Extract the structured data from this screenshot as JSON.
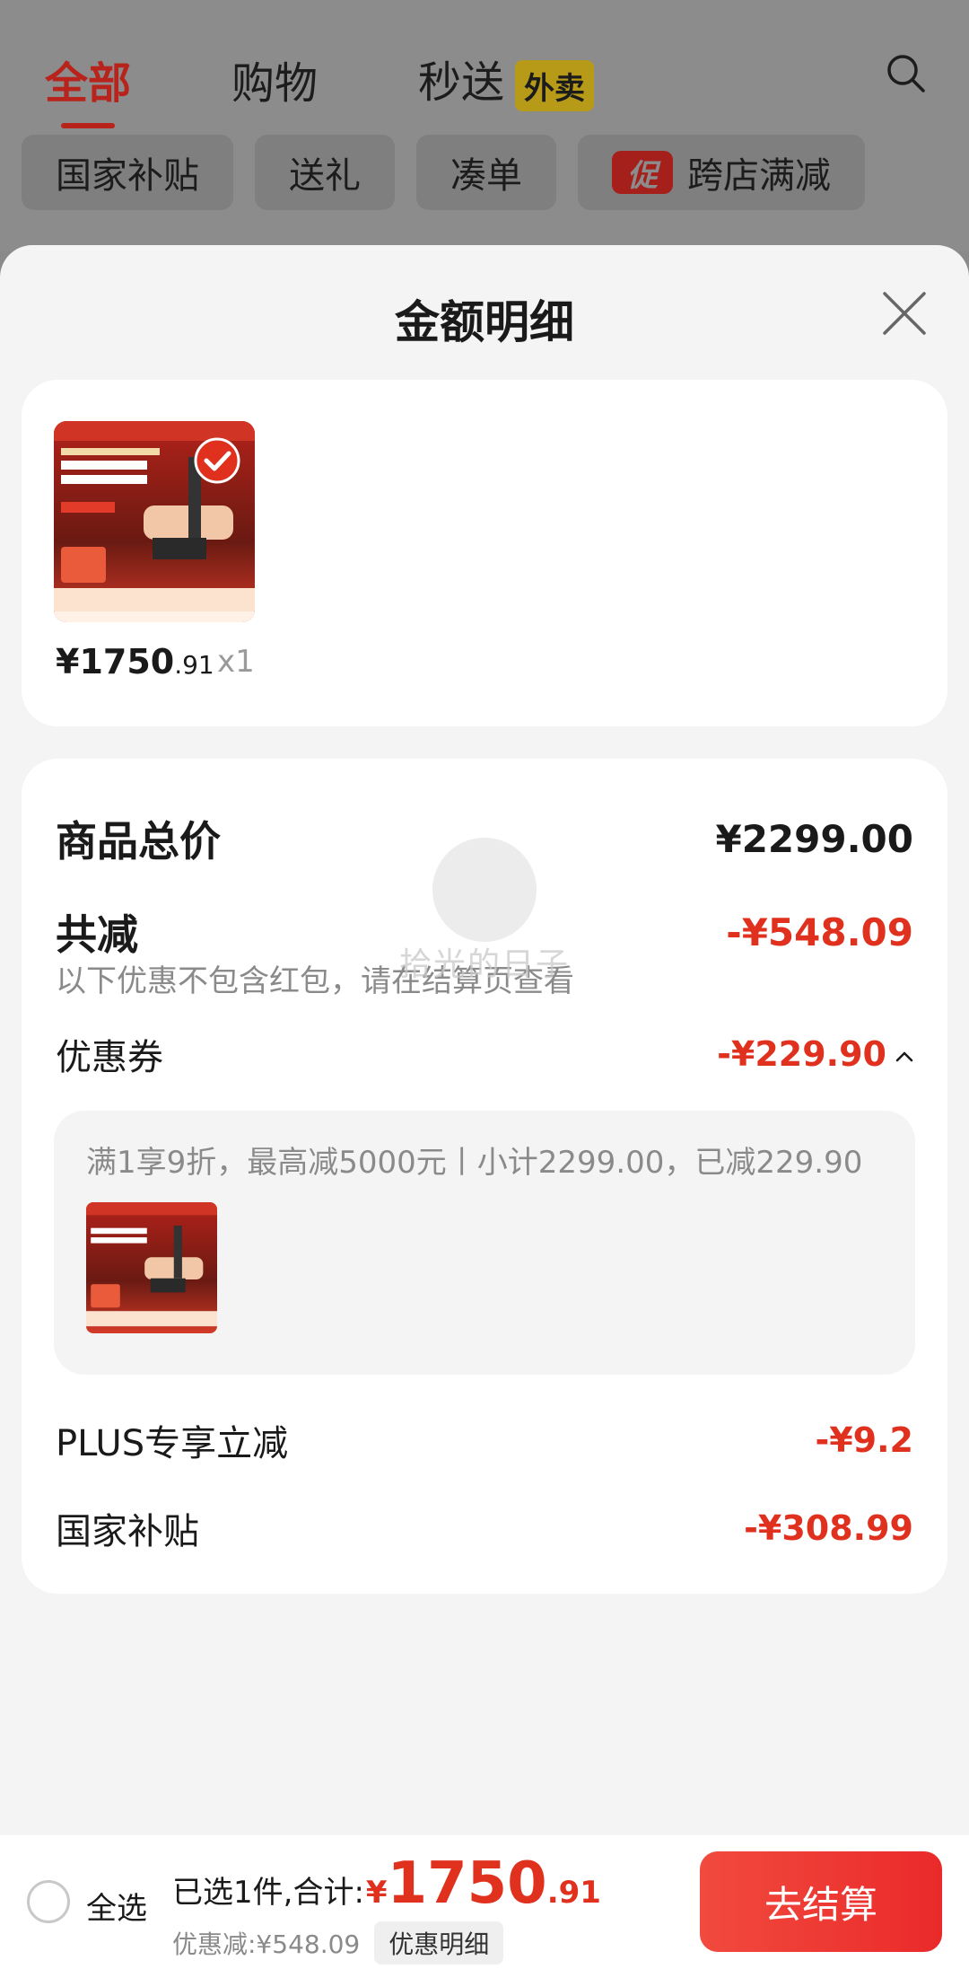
{
  "background": {
    "tabs": [
      {
        "label": "全部",
        "active": true
      },
      {
        "label": "购物",
        "active": false
      },
      {
        "label": "秒送",
        "active": false,
        "badge": "外卖"
      }
    ],
    "chips": [
      {
        "label": "国家补贴"
      },
      {
        "label": "送礼"
      },
      {
        "label": "凑单"
      },
      {
        "label": "跨店满减",
        "tag": "促"
      }
    ]
  },
  "sheet": {
    "title": "金额明细",
    "product": {
      "price_int": "¥1750",
      "price_dec": ".91",
      "qty": "x1",
      "selected": true
    },
    "summary": {
      "total_label": "商品总价",
      "total_value": "¥2299.00",
      "reduce_label": "共减",
      "reduce_value": "-¥548.09",
      "note": "以下优惠不包含红包，请在结算页查看",
      "coupon_label": "优惠券",
      "coupon_value": "-¥229.90",
      "coupon_detail": "满1享9折，最高减5000元丨小计2299.00，已减229.90",
      "plus_label": "PLUS专享立减",
      "plus_value": "-¥9.2",
      "subsidy_label": "国家补贴",
      "subsidy_value": "-¥308.99"
    },
    "watermark": "拾光的日子"
  },
  "bottom_bar": {
    "select_all": "全选",
    "selected_text": "已选1件,合计:",
    "currency": "¥",
    "total_int": "1750",
    "total_dec": ".91",
    "discount_text": "优惠减:¥548.09",
    "detail_button": "优惠明细",
    "checkout_button": "去结算"
  },
  "colors": {
    "accent_red": "#e0311f",
    "checkout_gradient_start": "#f14a3e",
    "checkout_gradient_end": "#ea2a2a"
  }
}
